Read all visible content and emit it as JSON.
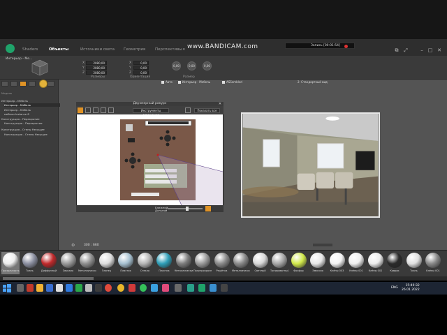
{
  "watermark": "www.BANDICAM.com",
  "recorder": {
    "label": "Запись [00:01:54]"
  },
  "tabs": [
    {
      "label": "Shaders",
      "active": false
    },
    {
      "label": "Объекты",
      "active": true
    },
    {
      "label": "Источники света",
      "active": false
    },
    {
      "label": "Геометрия",
      "active": false
    },
    {
      "label": "Перспективы",
      "active": false
    }
  ],
  "properties": {
    "object_name": "Интерьер - Ме...",
    "size_label": "Размеры",
    "orientation_label": "Ориентация",
    "scale_label": "Размер",
    "x_label": "X",
    "y_label": "Y",
    "z_label": "Z",
    "size_x": "2080,00",
    "size_y": "2080,00",
    "size_z": "2080,00",
    "rot_x": "0,00",
    "rot_y": "0,00",
    "rot_z": "0,00",
    "circle_1": "0,00",
    "circle_2": "0,00",
    "circle_3": "0,00"
  },
  "tree": {
    "header": "Модель",
    "items": [
      {
        "label": "Интерьер - Мебель",
        "selected": false
      },
      {
        "label": "Интерьер - Мебель",
        "selected": true
      },
      {
        "label": "Интерьер - Мебель",
        "selected": false
      },
      {
        "label": "мебели Instance 8",
        "selected": false
      },
      {
        "label": "Конструкция - Перекрытие",
        "selected": false
      },
      {
        "label": "Конструкция - Перекрытие",
        "selected": false
      },
      {
        "label": "Конструкция - Стены Несущие",
        "selected": false
      },
      {
        "label": "Конструкция - Стены Несущие",
        "selected": false
      }
    ]
  },
  "filters": {
    "auto": "Авто",
    "interior": "Интерьер - Мебель",
    "assembly": "ASSembled",
    "camera": "2: Стандартный вид"
  },
  "plan_window": {
    "title": "Двухмерный ракурс",
    "button_left": "Инструменты освещения",
    "button_right": "Показать все",
    "near_label": "Ближний",
    "far_label": "Дальний"
  },
  "view_bottom": {
    "zoom_text": "300 : 660"
  },
  "materials": [
    {
      "label": "Прозрачность",
      "color": "#eeeeee"
    },
    {
      "label": "Ткань",
      "color": "#8b8fa0"
    },
    {
      "label": "Диффузный",
      "color": "#c0292b"
    },
    {
      "label": "Зеркало",
      "color": "#9a9a9a"
    },
    {
      "label": "Металлический",
      "color": "#8e8e8e"
    },
    {
      "label": "Глянец",
      "color": "#dddddd"
    },
    {
      "label": "Пластик",
      "color": "#a6c0d0"
    },
    {
      "label": "Стекло",
      "color": "#b5b5b5"
    },
    {
      "label": "Пластик",
      "color": "#2f9fb8"
    },
    {
      "label": "Металлический",
      "color": "#7d7d7d"
    },
    {
      "label": "Полупрозрачный",
      "color": "#9a9a9a"
    },
    {
      "label": "Решётка",
      "color": "#8a8a8a"
    },
    {
      "label": "Металлический",
      "color": "#8a8a8a"
    },
    {
      "label": "Светлый",
      "color": "#d8d8d8"
    },
    {
      "label": "Тонированный",
      "color": "#a8a8a8"
    },
    {
      "label": "Фосфор",
      "color": "#d0e84a"
    },
    {
      "label": "Эмиссия",
      "color": "#e8e8e8"
    },
    {
      "label": "Клёны 003",
      "color": "#f4f4f4"
    },
    {
      "label": "Клёны 001",
      "color": "#f0f0f0"
    },
    {
      "label": "Клёны 002",
      "color": "#ececec"
    },
    {
      "label": "Коврик",
      "color": "#2a2a2a"
    },
    {
      "label": "Ткань",
      "color": "#e0e0e0"
    },
    {
      "label": "Клёны 001",
      "color": "#888888"
    }
  ],
  "taskbar": {
    "language": "ENG",
    "time": "15:49:32",
    "date": "26.01.2022"
  },
  "colors": {
    "accent": "#e09326",
    "app_bg": "#545454",
    "brand": "#1fa36a"
  }
}
